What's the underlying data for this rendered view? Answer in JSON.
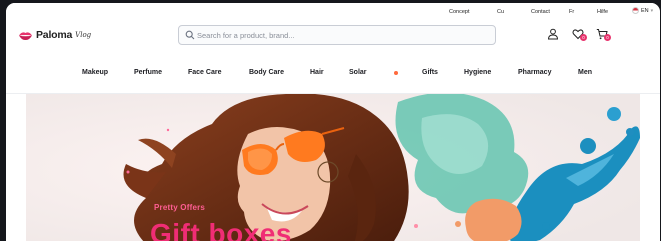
{
  "utility_bar": {
    "links": [
      "Concept",
      "Cu",
      "Contact",
      "Fr",
      "Hilfe"
    ],
    "language": "EN"
  },
  "header": {
    "brand_name": "Paloma",
    "brand_script": "Vlog",
    "search_placeholder": "Search for a product, brand...",
    "wishlist_count": "0",
    "cart_count": "0"
  },
  "nav": {
    "items": [
      "Makeup",
      "Perfume",
      "Face Care",
      "Body Care",
      "Hair",
      "Solar",
      "Gifts",
      "Hygiene",
      "Pharmacy",
      "Men"
    ]
  },
  "hero": {
    "caption": "Pretty Offers",
    "headline": "Gift boxes"
  },
  "colors": {
    "accent": "#e8336d",
    "headline": "#f02d75",
    "nav_dot": "#ff6a3d"
  }
}
